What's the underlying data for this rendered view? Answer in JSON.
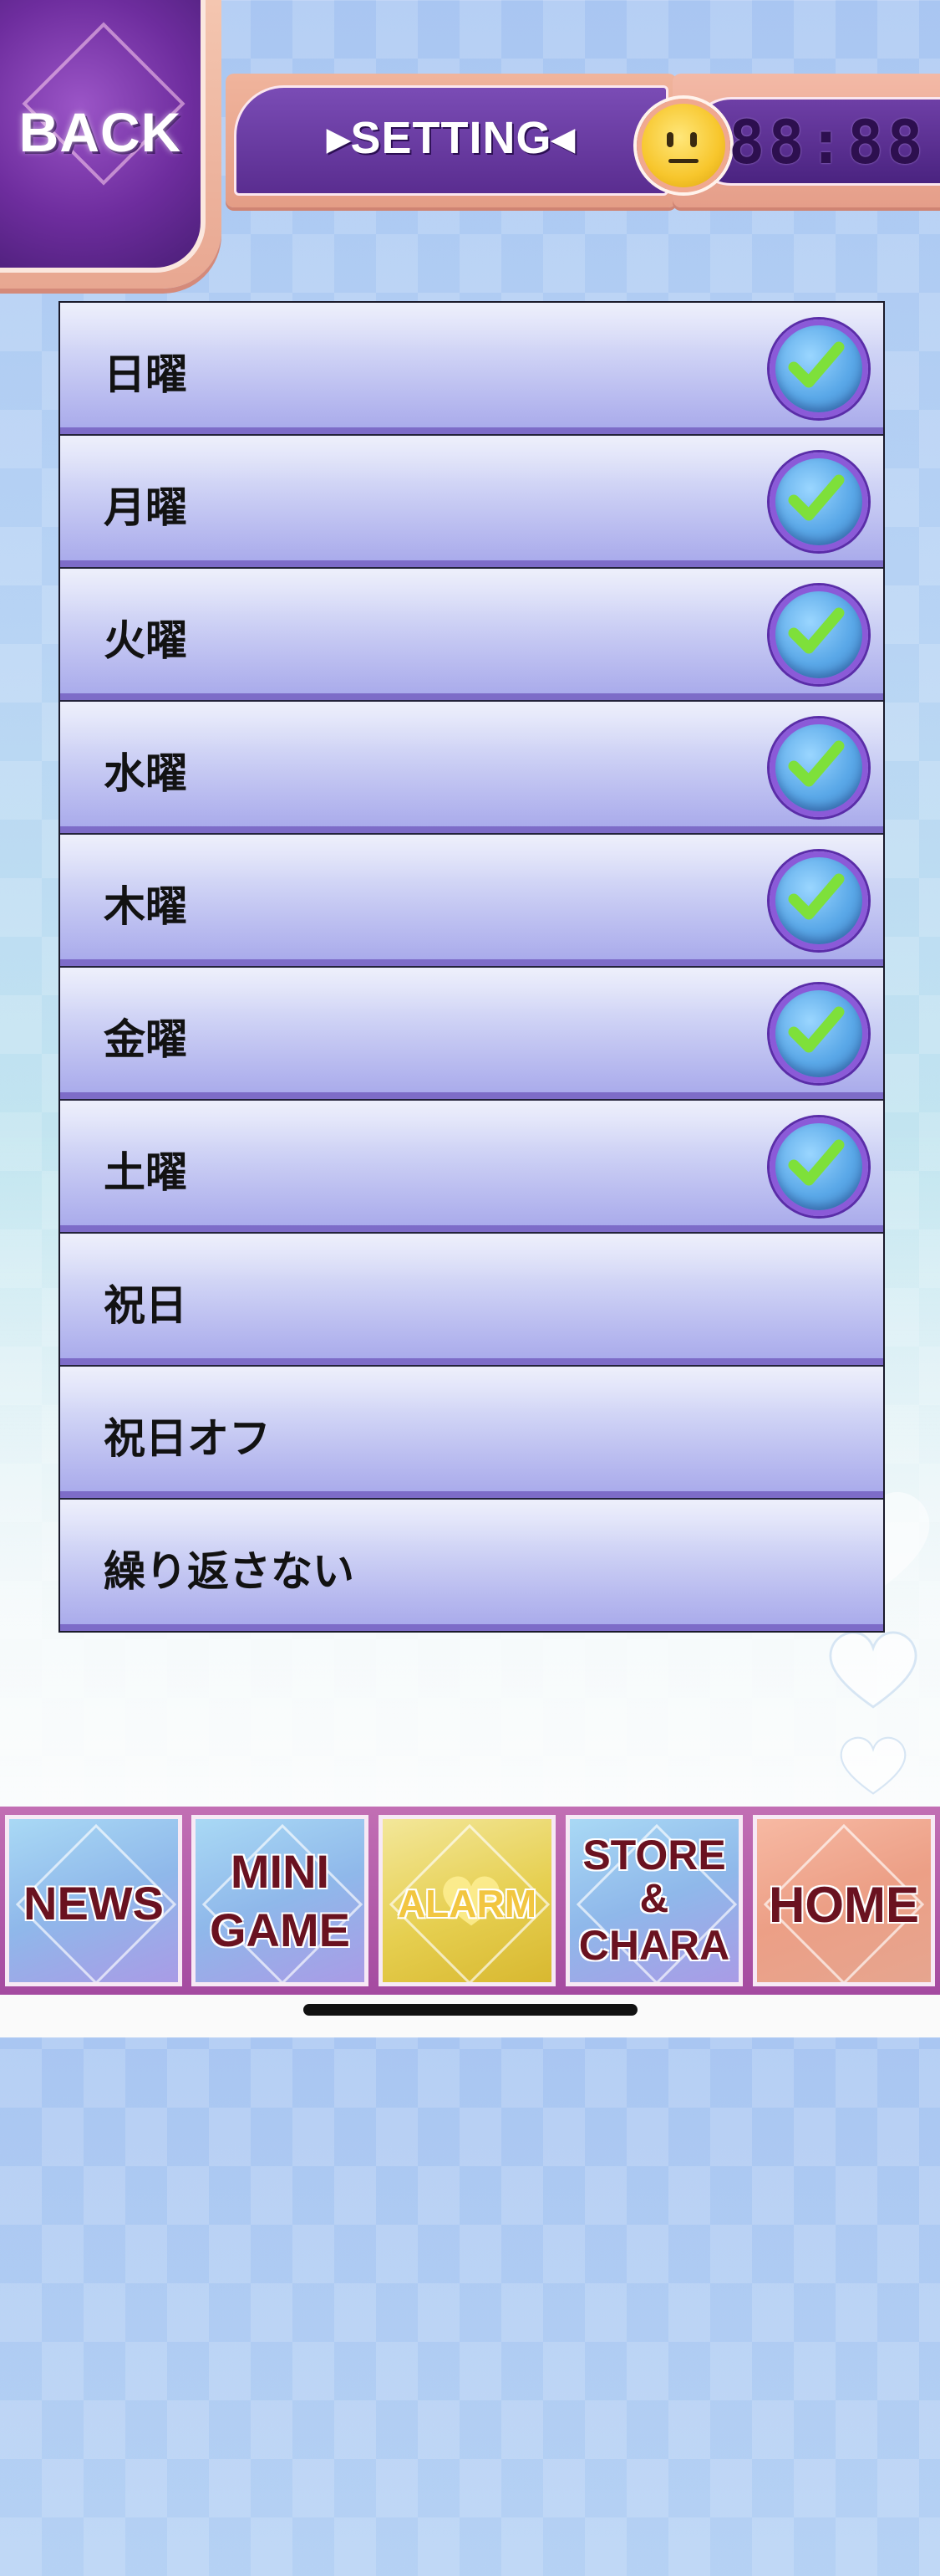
{
  "header": {
    "back_label": "BACK",
    "title": "▸SETTING◂",
    "clock": "88:88"
  },
  "days": [
    {
      "label": "日曜",
      "checked": true
    },
    {
      "label": "月曜",
      "checked": true
    },
    {
      "label": "火曜",
      "checked": true
    },
    {
      "label": "水曜",
      "checked": true
    },
    {
      "label": "木曜",
      "checked": true
    },
    {
      "label": "金曜",
      "checked": true
    },
    {
      "label": "土曜",
      "checked": true
    },
    {
      "label": "祝日",
      "checked": false
    },
    {
      "label": "祝日オフ",
      "checked": false
    },
    {
      "label": "繰り返さない",
      "checked": false
    }
  ],
  "nav": {
    "news": "NEWS",
    "mini": "MINI",
    "game": "GAME",
    "alarm": "ALARM",
    "store": "STORE",
    "amp": "&",
    "chara": "CHARA",
    "home": "HOME"
  },
  "colors": {
    "accent_purple": "#6e2d9e",
    "check_green": "#7ee03a",
    "row_bottom": "#7d6cc8"
  }
}
